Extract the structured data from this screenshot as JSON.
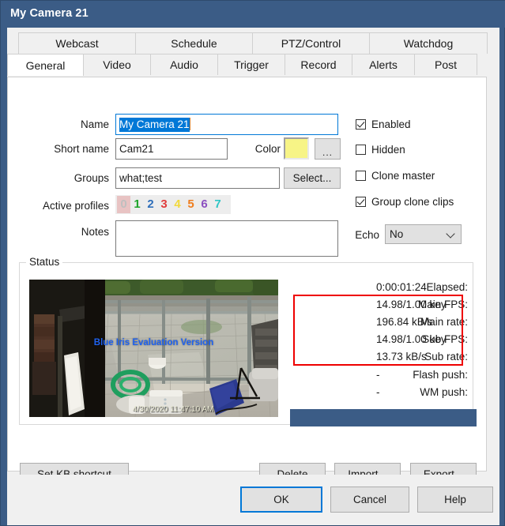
{
  "window": {
    "title": "My Camera 21",
    "frame_color": "#3b5c86"
  },
  "tabs": {
    "top_row": [
      {
        "label": "Webcast"
      },
      {
        "label": "Schedule"
      },
      {
        "label": "PTZ/Control"
      },
      {
        "label": "Watchdog"
      }
    ],
    "bottom_row": [
      {
        "label": "General",
        "active": true
      },
      {
        "label": "Video",
        "active": false
      },
      {
        "label": "Audio",
        "active": false
      },
      {
        "label": "Trigger",
        "active": false
      },
      {
        "label": "Record",
        "active": false
      },
      {
        "label": "Alerts",
        "active": false
      },
      {
        "label": "Post",
        "active": false
      }
    ]
  },
  "form": {
    "name_label": "Name",
    "name_value": "My Camera 21",
    "short_name_label": "Short name",
    "short_name_value": "Cam21",
    "color_label": "Color",
    "color_value": "#f7f486",
    "color_more_button": "...",
    "groups_label": "Groups",
    "groups_value": "what;test",
    "groups_select_button": "Select...",
    "active_profiles_label": "Active profiles",
    "profiles": [
      {
        "num": "0",
        "color": "#c0c0c0",
        "selected": true
      },
      {
        "num": "1",
        "color": "#1ea52a",
        "selected": false
      },
      {
        "num": "2",
        "color": "#2f6fba",
        "selected": false
      },
      {
        "num": "3",
        "color": "#e03c3c",
        "selected": false
      },
      {
        "num": "4",
        "color": "#f2d93b",
        "selected": false
      },
      {
        "num": "5",
        "color": "#ef7d1e",
        "selected": false
      },
      {
        "num": "6",
        "color": "#8b4fc0",
        "selected": false
      },
      {
        "num": "7",
        "color": "#2fc6c6",
        "selected": false
      }
    ],
    "notes_label": "Notes",
    "notes_value": ""
  },
  "options": {
    "checkboxes": [
      {
        "label": "Enabled",
        "checked": true
      },
      {
        "label": "Hidden",
        "checked": false
      },
      {
        "label": "Clone master",
        "checked": false
      },
      {
        "label": "Group clone clips",
        "checked": true
      }
    ],
    "echo_label": "Echo",
    "echo_value": "No"
  },
  "status": {
    "group_title": "Status",
    "preview": {
      "watermark": "Blue Iris Evaluation Version",
      "timestamp": "4/30/2020 11:47:10 AM"
    },
    "stats": [
      {
        "key": "Elapsed:",
        "value": "0:00:01:24",
        "highlighted": false
      },
      {
        "key": "Main FPS:",
        "value": "14.98/1.00 key",
        "highlighted": true
      },
      {
        "key": "Main rate:",
        "value": "196.84 kB/s",
        "highlighted": true
      },
      {
        "key": "Sub FPS:",
        "value": "14.98/1.00 key",
        "highlighted": true
      },
      {
        "key": "Sub rate:",
        "value": "13.73 kB/s",
        "highlighted": true
      },
      {
        "key": "Flash push:",
        "value": "-",
        "highlighted": false
      },
      {
        "key": "WM push:",
        "value": "-",
        "highlighted": false
      }
    ],
    "highlight_color": "#ee0000",
    "progress_color": "#3b5c86"
  },
  "actions": {
    "set_kb_shortcut": "Set KB shortcut",
    "delete": "Delete",
    "delete_accel": "D",
    "import": "Import...",
    "import_accel": "I",
    "export": "Export...",
    "export_accel": "E"
  },
  "dialog_buttons": {
    "ok": "OK",
    "cancel": "Cancel",
    "help": "Help"
  }
}
